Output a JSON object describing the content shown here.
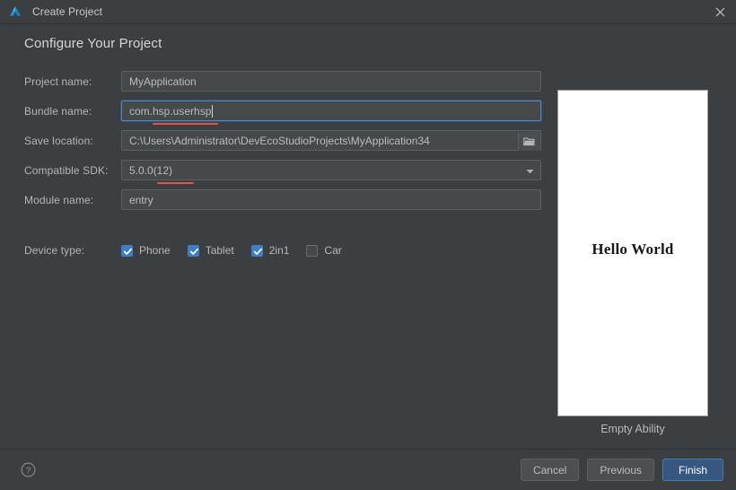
{
  "window": {
    "title": "Create Project",
    "logo_icon": "deveco-logo-icon",
    "close_icon": "close-icon"
  },
  "heading": "Configure Your Project",
  "form": {
    "fields": [
      {
        "label": "Project name:",
        "value": "MyApplication",
        "type": "text",
        "name": "project-name"
      },
      {
        "label": "Bundle name:",
        "value": "com.hsp.userhsp",
        "type": "text",
        "name": "bundle-name",
        "focused": true,
        "error_underline": true
      },
      {
        "label": "Save location:",
        "value": "C:\\Users\\Administrator\\DevEcoStudioProjects\\MyApplication34",
        "type": "text-with-browse",
        "name": "save-location",
        "browse_icon": "folder-icon"
      },
      {
        "label": "Compatible SDK:",
        "value": "5.0.0(12)",
        "type": "combobox",
        "name": "compatible-sdk",
        "dropdown_icon": "chevron-down-icon",
        "error_underline": true
      },
      {
        "label": "Module name:",
        "value": "entry",
        "type": "text",
        "name": "module-name"
      }
    ],
    "device_type": {
      "label": "Device type:",
      "options": [
        {
          "label": "Phone",
          "checked": true
        },
        {
          "label": "Tablet",
          "checked": true
        },
        {
          "label": "2in1",
          "checked": true
        },
        {
          "label": "Car",
          "checked": false
        }
      ]
    }
  },
  "preview": {
    "text": "Hello World",
    "caption": "Empty Ability"
  },
  "footer": {
    "help_icon": "help-circle-icon",
    "buttons": [
      {
        "label": "Cancel",
        "primary": false,
        "name": "cancel-button"
      },
      {
        "label": "Previous",
        "primary": false,
        "name": "previous-button"
      },
      {
        "label": "Finish",
        "primary": true,
        "name": "finish-button"
      }
    ]
  },
  "colors": {
    "background": "#3c3f41",
    "field_background": "#45494a",
    "accent_blue": "#3d7ec4",
    "primary_button": "#365880",
    "error_red": "#e8544a",
    "focus_border": "#4a88c7"
  }
}
